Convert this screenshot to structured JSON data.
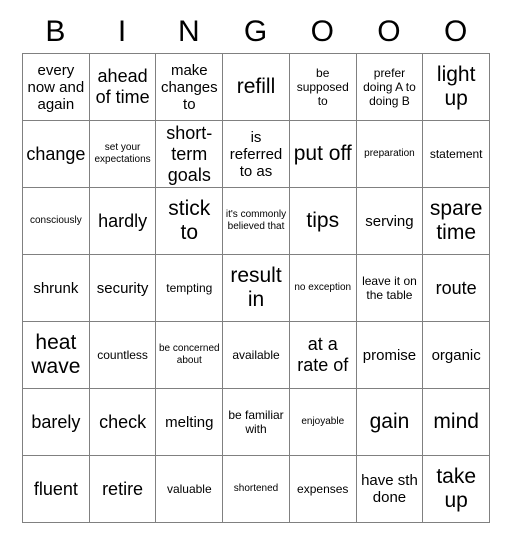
{
  "card": {
    "title": "BINGOOO",
    "columns": 7,
    "rows": 7,
    "header_letters": [
      "B",
      "I",
      "N",
      "G",
      "O",
      "O",
      "O"
    ],
    "grid_line_color": "#808080",
    "background_color": "#ffffff",
    "text_color": "#000000",
    "cells": [
      [
        {
          "text": "every now and again",
          "size": "s-md"
        },
        {
          "text": "ahead of time",
          "size": "s-lg"
        },
        {
          "text": "make changes to",
          "size": "s-md"
        },
        {
          "text": "refill",
          "size": "s-xl"
        },
        {
          "text": "be supposed to",
          "size": "s-sm"
        },
        {
          "text": "prefer doing A to doing B",
          "size": "s-sm"
        },
        {
          "text": "light up",
          "size": "s-xl"
        }
      ],
      [
        {
          "text": "change",
          "size": "s-lg"
        },
        {
          "text": "set your expectations",
          "size": "s-xs"
        },
        {
          "text": "short-term goals",
          "size": "s-lg"
        },
        {
          "text": "is referred to as",
          "size": "s-md"
        },
        {
          "text": "put off",
          "size": "s-xl"
        },
        {
          "text": "preparation",
          "size": "s-xs"
        },
        {
          "text": "statement",
          "size": "s-sm"
        }
      ],
      [
        {
          "text": "consciously",
          "size": "s-xs"
        },
        {
          "text": "hardly",
          "size": "s-lg"
        },
        {
          "text": "stick to",
          "size": "s-xl"
        },
        {
          "text": "it's commonly believed that",
          "size": "s-xs"
        },
        {
          "text": "tips",
          "size": "s-xl"
        },
        {
          "text": "serving",
          "size": "s-md"
        },
        {
          "text": "spare time",
          "size": "s-xl"
        }
      ],
      [
        {
          "text": "shrunk",
          "size": "s-md"
        },
        {
          "text": "security",
          "size": "s-md"
        },
        {
          "text": "tempting",
          "size": "s-sm"
        },
        {
          "text": "result in",
          "size": "s-xl"
        },
        {
          "text": "no exception",
          "size": "s-xs"
        },
        {
          "text": "leave it on the table",
          "size": "s-sm"
        },
        {
          "text": "route",
          "size": "s-lg"
        }
      ],
      [
        {
          "text": "heat wave",
          "size": "s-xl"
        },
        {
          "text": "countless",
          "size": "s-sm"
        },
        {
          "text": "be concerned about",
          "size": "s-xs"
        },
        {
          "text": "available",
          "size": "s-sm"
        },
        {
          "text": "at a rate of",
          "size": "s-lg"
        },
        {
          "text": "promise",
          "size": "s-md"
        },
        {
          "text": "organic",
          "size": "s-md"
        }
      ],
      [
        {
          "text": "barely",
          "size": "s-lg"
        },
        {
          "text": "check",
          "size": "s-lg"
        },
        {
          "text": "melting",
          "size": "s-md"
        },
        {
          "text": "be familiar with",
          "size": "s-sm"
        },
        {
          "text": "enjoyable",
          "size": "s-xs"
        },
        {
          "text": "gain",
          "size": "s-xl"
        },
        {
          "text": "mind",
          "size": "s-xl"
        }
      ],
      [
        {
          "text": "fluent",
          "size": "s-lg"
        },
        {
          "text": "retire",
          "size": "s-lg"
        },
        {
          "text": "valuable",
          "size": "s-sm"
        },
        {
          "text": "shortened",
          "size": "s-xs"
        },
        {
          "text": "expenses",
          "size": "s-sm"
        },
        {
          "text": "have sth done",
          "size": "s-md"
        },
        {
          "text": "take up",
          "size": "s-xl"
        }
      ]
    ]
  }
}
